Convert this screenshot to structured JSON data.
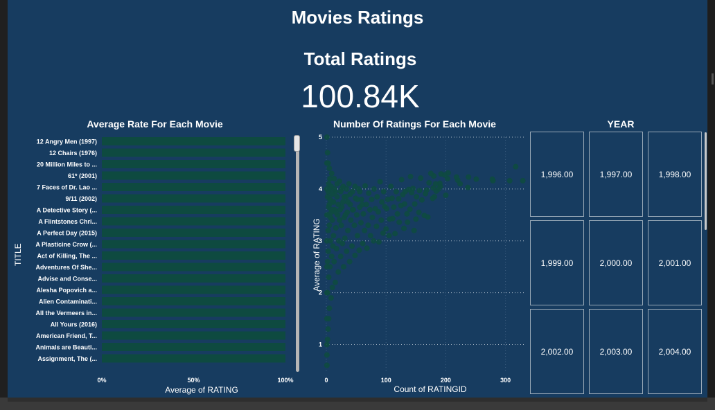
{
  "report": {
    "title": "Movies Ratings",
    "kpi_label": "Total Ratings",
    "kpi_value": "100.84K"
  },
  "visuals": {
    "bar_title": "Average Rate For Each Movie",
    "scatter_title": "Number Of Ratings For Each Movie",
    "year_title": "YEAR"
  },
  "year_tiles": [
    "1,996.00",
    "1,997.00",
    "1,998.00",
    "1,999.00",
    "2,000.00",
    "2,001.00",
    "2,002.00",
    "2,003.00",
    "2,004.00"
  ],
  "colors": {
    "background": "#173c60",
    "mark": "#0e4a40",
    "tile_border": "#9aaab8"
  },
  "chart_data": [
    {
      "type": "bar",
      "orientation": "horizontal",
      "title": "Average Rate For Each Movie",
      "xlabel": "Average of RATING",
      "ylabel": "TITLE",
      "x_ticks": [
        "0%",
        "50%",
        "100%"
      ],
      "xlim": [
        0,
        100
      ],
      "categories": [
        "12 Angry Men (1997)",
        "12 Chairs (1976)",
        "20 Million Miles to ...",
        "61* (2001)",
        "7 Faces of Dr. Lao ...",
        "9/11 (2002)",
        "A Detective Story (...",
        "A Flintstones Chri...",
        "A Perfect Day (2015)",
        "A Plasticine Crow (...",
        "Act of Killing, The ...",
        "Adventures Of She...",
        "Advise and Conse...",
        "Alesha Popovich a...",
        "Alien Contaminati...",
        "All the Vermeers in...",
        "All Yours (2016)",
        "American Friend, T...",
        "Animals are Beauti...",
        "Assignment, The (..."
      ],
      "values": [
        100,
        100,
        100,
        100,
        100,
        100,
        100,
        100,
        100,
        100,
        100,
        100,
        100,
        100,
        100,
        100,
        100,
        100,
        100,
        100
      ]
    },
    {
      "type": "scatter",
      "title": "Number Of Ratings For Each Movie",
      "xlabel": "Count of RATINGID",
      "ylabel": "Average of RATING",
      "x_ticks": [
        0,
        100,
        200,
        300
      ],
      "y_ticks": [
        1,
        2,
        3,
        4,
        5
      ],
      "xlim": [
        0,
        348
      ],
      "ylim": [
        0.5,
        5
      ],
      "grid": true,
      "points": [
        [
          329.0,
          4.16
        ],
        [
          317.0,
          4.43
        ],
        [
          307.0,
          4.16
        ],
        [
          279.0,
          4.16
        ],
        [
          278.0,
          4.19
        ],
        [
          251.0,
          4.19
        ],
        [
          238.0,
          4.23
        ],
        [
          237.0,
          4.03
        ],
        [
          224.0,
          4.1
        ],
        [
          220.0,
          4.17
        ],
        [
          218.0,
          4.23
        ],
        [
          204.0,
          4.31
        ],
        [
          203.0,
          4.2
        ],
        [
          200.0,
          3.88
        ],
        [
          198.0,
          4.27
        ],
        [
          192.0,
          4.29
        ],
        [
          191.0,
          4.05
        ],
        [
          190.0,
          4.11
        ],
        [
          188.0,
          4.0
        ],
        [
          184.0,
          3.96
        ],
        [
          183.0,
          4.1
        ],
        [
          181.0,
          3.85
        ],
        [
          180.0,
          4.25
        ],
        [
          179.0,
          4.02
        ],
        [
          178.0,
          3.82
        ],
        [
          175.0,
          4.3
        ],
        [
          172.0,
          4.12
        ],
        [
          170.0,
          3.46
        ],
        [
          168.0,
          3.98
        ],
        [
          166.0,
          3.91
        ],
        [
          164.0,
          3.49
        ],
        [
          160.0,
          3.79
        ],
        [
          158.0,
          4.21
        ],
        [
          156.0,
          3.97
        ],
        [
          155.0,
          3.55
        ],
        [
          151.0,
          3.85
        ],
        [
          150.0,
          3.42
        ],
        [
          148.0,
          3.71
        ],
        [
          147.0,
          3.2
        ],
        [
          145.0,
          4.01
        ],
        [
          143.0,
          3.93
        ],
        [
          141.0,
          4.24
        ],
        [
          140.0,
          3.61
        ],
        [
          138.0,
          3.99
        ],
        [
          136.0,
          3.36
        ],
        [
          135.0,
          3.52
        ],
        [
          132.0,
          3.95
        ],
        [
          131.0,
          3.71
        ],
        [
          130.0,
          3.24
        ],
        [
          128.0,
          3.89
        ],
        [
          126.0,
          4.18
        ],
        [
          125.0,
          3.68
        ],
        [
          122.0,
          3.36
        ],
        [
          121.0,
          3.81
        ],
        [
          119.0,
          3.52
        ],
        [
          117.0,
          3.95
        ],
        [
          115.0,
          3.14
        ],
        [
          113.0,
          3.65
        ],
        [
          111.0,
          3.43
        ],
        [
          110.0,
          3.82
        ],
        [
          108.0,
          4.05
        ],
        [
          106.0,
          3.42
        ],
        [
          105.0,
          3.1
        ],
        [
          103.0,
          3.8
        ],
        [
          101.0,
          3.62
        ],
        [
          100.0,
          3.23
        ],
        [
          98.0,
          3.66
        ],
        [
          96.0,
          3.95
        ],
        [
          95.0,
          3.15
        ],
        [
          93.0,
          3.75
        ],
        [
          92.0,
          3.4
        ],
        [
          90.0,
          4.14
        ],
        [
          88.0,
          2.98
        ],
        [
          87.0,
          3.56
        ],
        [
          85.0,
          3.85
        ],
        [
          84.0,
          3.28
        ],
        [
          82.0,
          3.62
        ],
        [
          80.0,
          4.0
        ],
        [
          79.0,
          3.0
        ],
        [
          77.0,
          3.45
        ],
        [
          76.0,
          3.8
        ],
        [
          74.0,
          3.1
        ],
        [
          73.0,
          3.6
        ],
        [
          71.0,
          3.92
        ],
        [
          70.0,
          3.3
        ],
        [
          68.0,
          2.86
        ],
        [
          67.0,
          3.7
        ],
        [
          65.0,
          4.06
        ],
        [
          64.0,
          3.2
        ],
        [
          62.0,
          3.52
        ],
        [
          61.0,
          2.95
        ],
        [
          59.0,
          3.8
        ],
        [
          58.0,
          3.35
        ],
        [
          56.0,
          3.65
        ],
        [
          55.0,
          2.82
        ],
        [
          54.0,
          4.0
        ],
        [
          52.0,
          3.1
        ],
        [
          51.0,
          3.5
        ],
        [
          49.0,
          3.82
        ],
        [
          48.0,
          2.72
        ],
        [
          47.0,
          3.3
        ],
        [
          45.0,
          3.6
        ],
        [
          44.0,
          3.95
        ],
        [
          43.0,
          2.9
        ],
        [
          41.0,
          3.4
        ],
        [
          40.0,
          3.7
        ],
        [
          39.0,
          2.6
        ],
        [
          38.0,
          4.1
        ],
        [
          36.0,
          3.2
        ],
        [
          35.0,
          3.55
        ],
        [
          34.0,
          2.8
        ],
        [
          33.0,
          3.85
        ],
        [
          31.0,
          3.05
        ],
        [
          30.0,
          3.45
        ],
        [
          29.0,
          2.5
        ],
        [
          28.0,
          3.75
        ],
        [
          27.0,
          2.95
        ],
        [
          26.0,
          4.0
        ],
        [
          25.0,
          3.3
        ],
        [
          24.0,
          2.7
        ],
        [
          23.0,
          3.6
        ],
        [
          22.0,
          4.15
        ],
        [
          21.0,
          3.0
        ],
        [
          20.0,
          2.4
        ],
        [
          19.0,
          3.5
        ],
        [
          18.0,
          3.85
        ],
        [
          17.0,
          2.85
        ],
        [
          16.0,
          3.25
        ],
        [
          15.0,
          2.2
        ],
        [
          15.0,
          3.95
        ],
        [
          14.0,
          3.6
        ],
        [
          13.0,
          2.6
        ],
        [
          13.0,
          4.2
        ],
        [
          12.0,
          3.1
        ],
        [
          11.0,
          2.9
        ],
        [
          11.0,
          3.75
        ],
        [
          10.0,
          2.1
        ],
        [
          10.0,
          3.4
        ],
        [
          9.0,
          4.3
        ],
        [
          9.0,
          2.7
        ],
        [
          8.0,
          3.55
        ],
        [
          8.0,
          1.9
        ],
        [
          7.0,
          3.0
        ],
        [
          7.0,
          4.0
        ],
        [
          6.0,
          2.5
        ],
        [
          6.0,
          3.8
        ],
        [
          5.0,
          1.7
        ],
        [
          5.0,
          3.3
        ],
        [
          5.0,
          4.4
        ],
        [
          4.0,
          2.3
        ],
        [
          4.0,
          3.65
        ],
        [
          4.0,
          1.5
        ],
        [
          3.0,
          2.8
        ],
        [
          3.0,
          4.5
        ],
        [
          3.0,
          3.2
        ],
        [
          3.0,
          1.3
        ],
        [
          2.0,
          2.0
        ],
        [
          2.0,
          3.5
        ],
        [
          2.0,
          4.7
        ],
        [
          2.0,
          1.1
        ],
        [
          2.0,
          2.6
        ],
        [
          1.0,
          1.0
        ],
        [
          1.0,
          3.0
        ],
        [
          1.0,
          4.0
        ],
        [
          1.0,
          5.0
        ],
        [
          1.0,
          2.0
        ],
        [
          1.0,
          1.5
        ],
        [
          1.0,
          2.5
        ],
        [
          1.0,
          3.5
        ],
        [
          1.0,
          4.5
        ],
        [
          1.0,
          0.6
        ],
        [
          1.0,
          0.8
        ],
        [
          2.0,
          3.85
        ],
        [
          3.0,
          3.95
        ],
        [
          4.0,
          4.1
        ],
        [
          5.0,
          3.7
        ],
        [
          6.0,
          4.2
        ],
        [
          7.0,
          3.45
        ],
        [
          8.0,
          4.05
        ],
        [
          9.0,
          3.6
        ],
        [
          10.0,
          3.9
        ],
        [
          12.0,
          3.75
        ],
        [
          14.0,
          4.0
        ],
        [
          16.0,
          3.55
        ],
        [
          18.0,
          4.1
        ],
        [
          20.0,
          3.7
        ],
        [
          22.0,
          3.4
        ],
        [
          24.0,
          3.95
        ],
        [
          26.0,
          3.65
        ],
        [
          28.0,
          4.05
        ],
        [
          30.0,
          3.85
        ],
        [
          32.0,
          3.5
        ],
        [
          34.0,
          4.0
        ],
        [
          36.0,
          3.75
        ],
        [
          40.0,
          3.9
        ],
        [
          44.0,
          3.6
        ],
        [
          48.0,
          4.05
        ],
        [
          52.0,
          3.8
        ],
        [
          56.0,
          3.95
        ],
        [
          60.0,
          3.7
        ]
      ]
    }
  ]
}
